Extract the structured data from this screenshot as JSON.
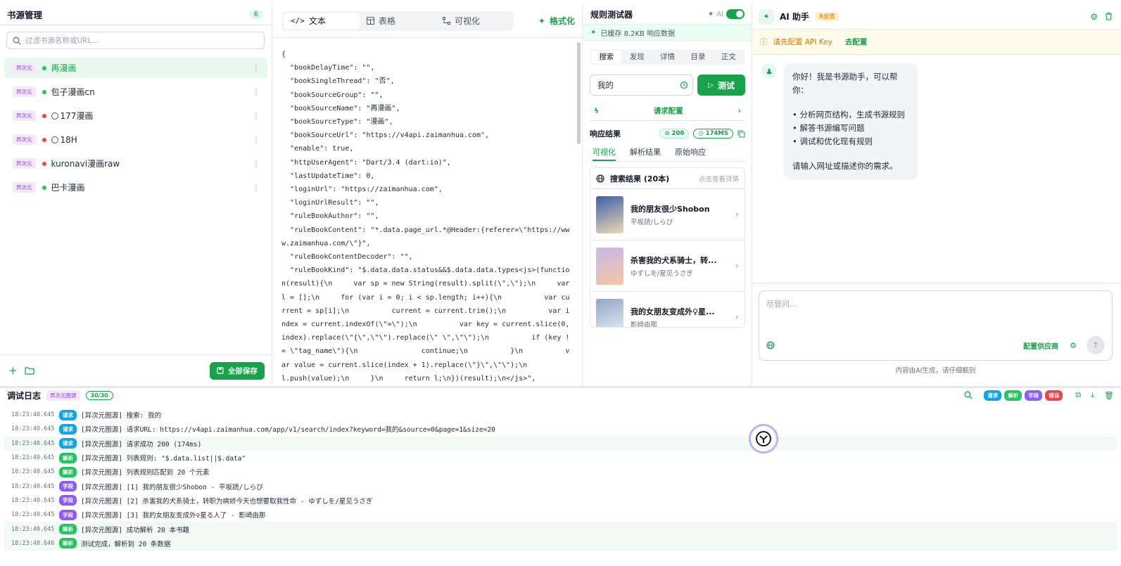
{
  "sources": {
    "title": "书源管理",
    "count": "6",
    "search_placeholder": "过滤书源名称或URL...",
    "items": [
      {
        "tag": "异次元",
        "name": "再漫画",
        "dot": "#22c55e",
        "circle": false
      },
      {
        "tag": "异次元",
        "name": "包子漫画cn",
        "dot": "#22c55e",
        "circle": false
      },
      {
        "tag": "异次元",
        "name": "177漫画",
        "dot": "#ef4444",
        "circle": true
      },
      {
        "tag": "异次元",
        "name": "18H",
        "dot": "#ef4444",
        "circle": true
      },
      {
        "tag": "异次元",
        "name": "kuronavi漫画raw",
        "dot": "#ef4444",
        "circle": false
      },
      {
        "tag": "异次元",
        "name": "巴卡漫画",
        "dot": "#22c55e",
        "circle": false
      }
    ],
    "save_all": "全部保存"
  },
  "editor": {
    "tabs": [
      "文本",
      "表格",
      "可视化"
    ],
    "format": "格式化",
    "code": "{\n  \"bookDelayTime\": \"\",\n  \"bookSingleThread\": \"否\",\n  \"bookSourceGroup\": \"\",\n  \"bookSourceName\": \"再漫画\",\n  \"bookSourceType\": \"漫画\",\n  \"bookSourceUrl\": \"https://v4api.zaimanhua.com\",\n  \"enable\": true,\n  \"httpUserAgent\": \"Dart/3.4 (dart:io)\",\n  \"lastUpdateTime\": 0,\n  \"loginUrl\": \"https://zaimanhua.com\",\n  \"loginUrlResult\": \"\",\n  \"ruleBookAuthor\": \"\",\n  \"ruleBookContent\": \"*.data.page_url.*@Header:{referer=\\\"https://www.zaimanhua.com/\\\"}\",\n  \"ruleBookContentDecoder\": \"\",\n  \"ruleBookKind\": \"$.data.data.status&&$.data.data.types<js>(function(result){\\n     var sp = new String(result).split(\\\",\\\");\\n     var l = [];\\n     for (var i = 0; i < sp.length; i++){\\n          var current = sp[i];\\n          current = current.trim();\\n          var index = current.indexOf(\\\"=\\\");\\n          var key = current.slice(0, index).replace(\\\"{\\\",\\\"\\\").replace(\\\" \\\",\\\"\\\");\\n          if (key != \\\"tag_name\\\"){\\n               continue;\\n          }\\n          var value = current.slice(index + 1).replace(\\\"}\\\",\\\"\\\");\\n          l.push(value);\\n     }\\n     return l;\\n})(result);\\n</js>\","
  },
  "tester": {
    "title": "规则测试器",
    "ai_label": "AI",
    "cache": "已缓存 8.2KB 响应数据",
    "tabs": [
      "搜索",
      "发现",
      "详情",
      "目录",
      "正文"
    ],
    "keyword": "我的",
    "test_btn": "测试",
    "request_config": "请求配置",
    "response_title": "响应结果",
    "status": "200",
    "time": "174MS",
    "result_tabs": [
      "可视化",
      "解析结果",
      "原始响应"
    ],
    "result_title": "搜索结果 (20本)",
    "result_hint": "点击查看详情",
    "books": [
      {
        "title": "我的朋友很少Shobon",
        "author": "平坂読/しらび",
        "c1": "#3b5fa8",
        "c2": "#f0d9b5"
      },
      {
        "title": "杀害我的犬系骑士，转...",
        "author": "ゆずしを/星见うさぎ",
        "c1": "#c7b8e8",
        "c2": "#f5c6a5"
      },
      {
        "title": "我的女朋友变成外♀星...",
        "author": "影崎由那",
        "c1": "#8ea6c8",
        "c2": "#eef2f7"
      }
    ]
  },
  "ai": {
    "title": "AI 助手",
    "status": "未配置",
    "warning": "请先配置 API Key",
    "warning_link": "去配置",
    "greeting": "你好！我是书源助手，可以帮你：",
    "points": [
      "• 分析网页结构，生成书源规则",
      "• 解答书源编写问题",
      "• 调试和优化现有规则"
    ],
    "closing": "请输入网址或描述你的需求。",
    "input_placeholder": "尽管问...",
    "provider": "配置供应商",
    "note": "内容由AI生成，请仔细甄别"
  },
  "log": {
    "title": "调试日志",
    "source": "异次元图源",
    "count": "30/30",
    "legend": [
      {
        "label": "请求",
        "color": "#0ea5e9"
      },
      {
        "label": "解析",
        "color": "#22c55e"
      },
      {
        "label": "字段",
        "color": "#8b5cf6"
      },
      {
        "label": "错误",
        "color": "#ef4444"
      }
    ],
    "rows": [
      {
        "time": "18:23:40.645",
        "type": "请求",
        "cls": "b-req",
        "msg": "[异次元图源] 搜索: 我的",
        "hl": false
      },
      {
        "time": "18:23:40.645",
        "type": "请求",
        "cls": "b-req",
        "msg": "[异次元图源] 请求URL: https://v4api.zaimanhua.com/app/v1/search/index?keyword=我的&source=0&page=1&size=20",
        "hl": false
      },
      {
        "time": "18:23:40.645",
        "type": "请求",
        "cls": "b-req",
        "msg": "[异次元图源] 请求成功 200 (174ms)",
        "hl": true
      },
      {
        "time": "18:23:40.645",
        "type": "解析",
        "cls": "b-parse",
        "msg": "[异次元图源] 列表规则: \"$.data.list||$.data\"",
        "hl": false
      },
      {
        "time": "18:23:40.645",
        "type": "解析",
        "cls": "b-parse",
        "msg": "[异次元图源] 列表规则匹配到 20 个元素",
        "hl": false
      },
      {
        "time": "18:23:40.645",
        "type": "字段",
        "cls": "b-field",
        "msg": "[异次元图源] [1] 我的朋友很少Shobon - 平坂読/しらび",
        "hl": false
      },
      {
        "time": "18:23:40.645",
        "type": "字段",
        "cls": "b-field",
        "msg": "[异次元图源] [2] 杀害我的犬系骑士，转职为病娇今天也想要取我性命 - ゆずしを/星见うさぎ",
        "hl": false
      },
      {
        "time": "18:23:40.645",
        "type": "字段",
        "cls": "b-field",
        "msg": "[异次元图源] [3] 我的女朋友变成外♀星る人了 - 影崎由那",
        "hl": false
      },
      {
        "time": "18:23:40.645",
        "type": "解析",
        "cls": "b-parse",
        "msg": "[异次元图源] 成功解析 20 本书籍",
        "hl": true
      },
      {
        "time": "18:23:40.646",
        "type": "解析",
        "cls": "b-parse",
        "msg": "测试完成，解析到 20 条数据",
        "hl": true
      }
    ]
  }
}
